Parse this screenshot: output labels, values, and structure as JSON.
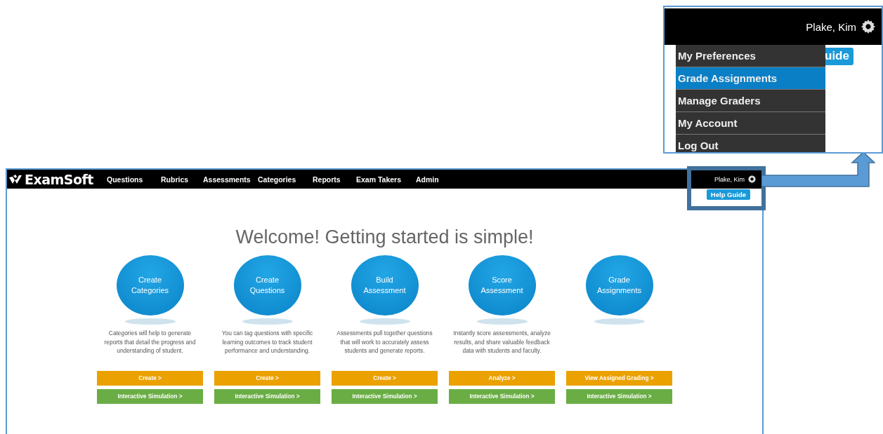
{
  "navbar": {
    "logo": "ExamSoft",
    "items": [
      "Questions",
      "Rubrics",
      "Assessments",
      "Categories",
      "Reports",
      "Exam Takers",
      "Admin"
    ],
    "user": "Plake, Kim",
    "help_guide": "Help Guide"
  },
  "welcome": "Welcome! Getting started is simple!",
  "steps": [
    {
      "title": [
        "Create",
        "Categories"
      ],
      "description": "Categories will help to generate reports that detail the progress and understanding of student.",
      "action": "Create >",
      "simulation": "Interactive Simulation >"
    },
    {
      "title": [
        "Create",
        "Questions"
      ],
      "description": "You can tag questions with specific learning outcomes to track student performance and understanding.",
      "action": "Create >",
      "simulation": "Interactive Simulation >"
    },
    {
      "title": [
        "Build",
        "Assessment"
      ],
      "description": "Assessments pull together questions that will work to accurately assess students and generate reports.",
      "action": "Create >",
      "simulation": "Interactive Simulation >"
    },
    {
      "title": [
        "Score",
        "Assessment"
      ],
      "description": "Instantly score assessments, analyze results, and share valuable feedback data with students and faculty.",
      "action": "Analyze >",
      "simulation": "Interactive Simulation >"
    },
    {
      "title": [
        "Grade",
        "Assignments"
      ],
      "action": "View Assigned Grading >",
      "simulation": "Interactive Simulation >"
    }
  ],
  "zoom_inset": {
    "user": "Plake, Kim",
    "help_guide_partial": "uide",
    "menu": [
      {
        "label": "My Preferences",
        "selected": false
      },
      {
        "label": "Grade Assignments",
        "selected": true
      },
      {
        "label": "Manage Graders",
        "selected": false
      },
      {
        "label": "My Account",
        "selected": false
      },
      {
        "label": "Log Out",
        "selected": false
      }
    ]
  }
}
